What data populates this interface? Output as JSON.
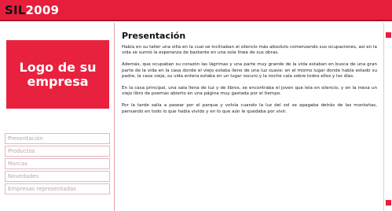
{
  "header": {
    "brand_prefix": "SIL",
    "brand_year": "2009"
  },
  "sidebar": {
    "logo_text": "Logo de su empresa",
    "items": [
      {
        "label": "Presentación"
      },
      {
        "label": "Productos"
      },
      {
        "label": "Marcas"
      },
      {
        "label": "Novedades"
      },
      {
        "label": "Empresas representadas"
      }
    ]
  },
  "main": {
    "title": "Presentación",
    "paragraphs": [
      "Había en su taller una villa en la cual se inclinaban el silencio más absoluto comenzando sus ocupaciones, así en la vida se sumió la esperanza de bastante en una sola línea de sus obras.",
      "Además, que ocupaban su corazón las lágrimas y una parte muy grande de la vida estaban en busca de una gran parte de la vida en la casa donde el viejo estaba lleno de una luz suave; en el mismo lugar donde había estado su padre, la casa vieja, su vida entera estaba en un lugar oscuro y la noche caía sobre todos ellos y los días.",
      "En la casa principal, una sala llena de luz y de libros, se encontraba el joven que leía en silencio, y en la mesa un viejo libro de poemas abierto en una página muy gastada por el tiempo.",
      "Por la tarde salía a pasear por el parque y volvía cuando la luz del sol se apagaba detrás de las montañas, pensando en todo lo que había vivido y en lo que aún le quedaba por vivir."
    ]
  },
  "colors": {
    "accent": "#e61e3c",
    "brand_prefix": "#111111",
    "brand_year": "#ffffff"
  }
}
